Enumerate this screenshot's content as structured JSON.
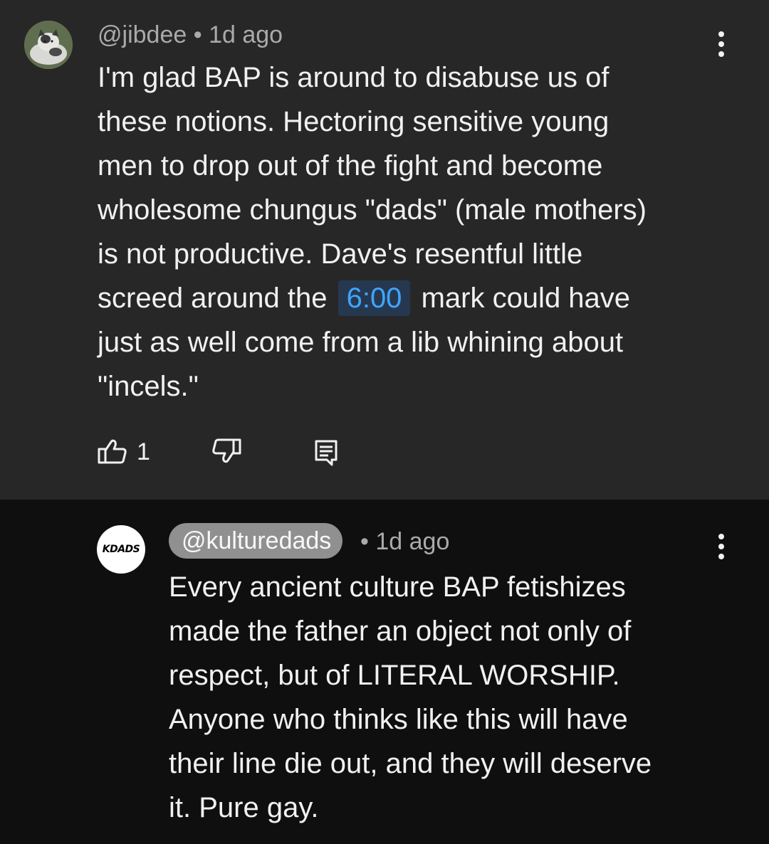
{
  "top_comment": {
    "author": "@jibdee",
    "separator": "•",
    "time": "1d ago",
    "lines": {
      "l1": "I'm glad BAP is around to disabuse us of",
      "l2": "these notions. Hectoring sensitive young",
      "l3": "men to drop out of the fight and become",
      "l4": "wholesome chungus \"dads\" (male mothers)",
      "l5": "is not productive. Dave's resentful little",
      "l6_before": "screed around the",
      "timestamp_link": "6:00",
      "l6_after": "mark could have",
      "l7": "just as well come from a lib whining about",
      "l8": "\"incels.\""
    },
    "like_count": "1",
    "icons": {
      "like": "thumbs-up-icon",
      "dislike": "thumbs-down-icon",
      "reply": "reply-comment-icon",
      "menu": "more-vertical-icon"
    }
  },
  "reply_comment": {
    "avatar_text": "KDADS",
    "author": "@kulturedads",
    "separator": "•",
    "time": "1d ago",
    "lines": {
      "l1": "Every ancient culture BAP fetishizes",
      "l2": "made the father an object not only of",
      "l3": "respect, but of LITERAL WORSHIP.",
      "l4": "Anyone who thinks like this will have",
      "l5": "their line die out, and they will deserve",
      "l6": "it. Pure gay."
    }
  },
  "colors": {
    "highlight_bg": "#272727",
    "page_bg": "#0f0f0f",
    "link": "#3ea6ff",
    "meta": "#aaaaaa",
    "author_chip": "#909090"
  }
}
